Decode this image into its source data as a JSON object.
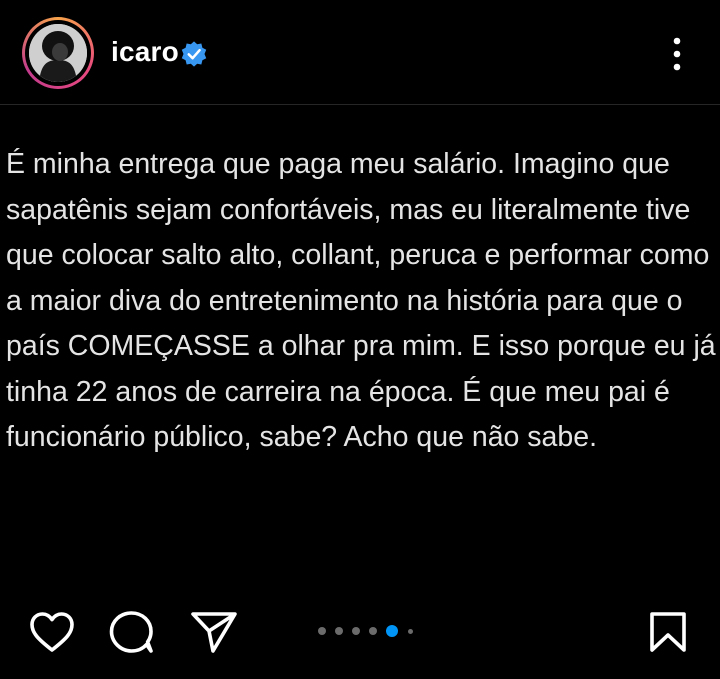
{
  "post": {
    "username": "icaro",
    "verified": true,
    "caption": "É minha entrega que paga meu salário. Imagino que sapatênis sejam confortáveis, mas eu literalmente tive que colocar salto alto, collant, peruca e performar como a maior diva do entretenimento na história para que o país COMEÇASSE a olhar pra mim. E isso porque eu já tinha 22 anos de carreira na época. É que meu pai é funcionário público, sabe? Acho que não sabe.",
    "carousel": {
      "total": 6,
      "active_index": 4
    }
  },
  "icons": {
    "avatar": "avatar",
    "verified": "verified-badge-icon",
    "more": "more-vertical-icon",
    "like": "heart-icon",
    "comment": "comment-icon",
    "share": "send-icon",
    "save": "bookmark-icon"
  },
  "colors": {
    "background": "#000000",
    "text": "#e4e4e4",
    "verified": "#3897f0",
    "active_dot": "#0095f6",
    "inactive_dot": "#6b6b6b"
  }
}
